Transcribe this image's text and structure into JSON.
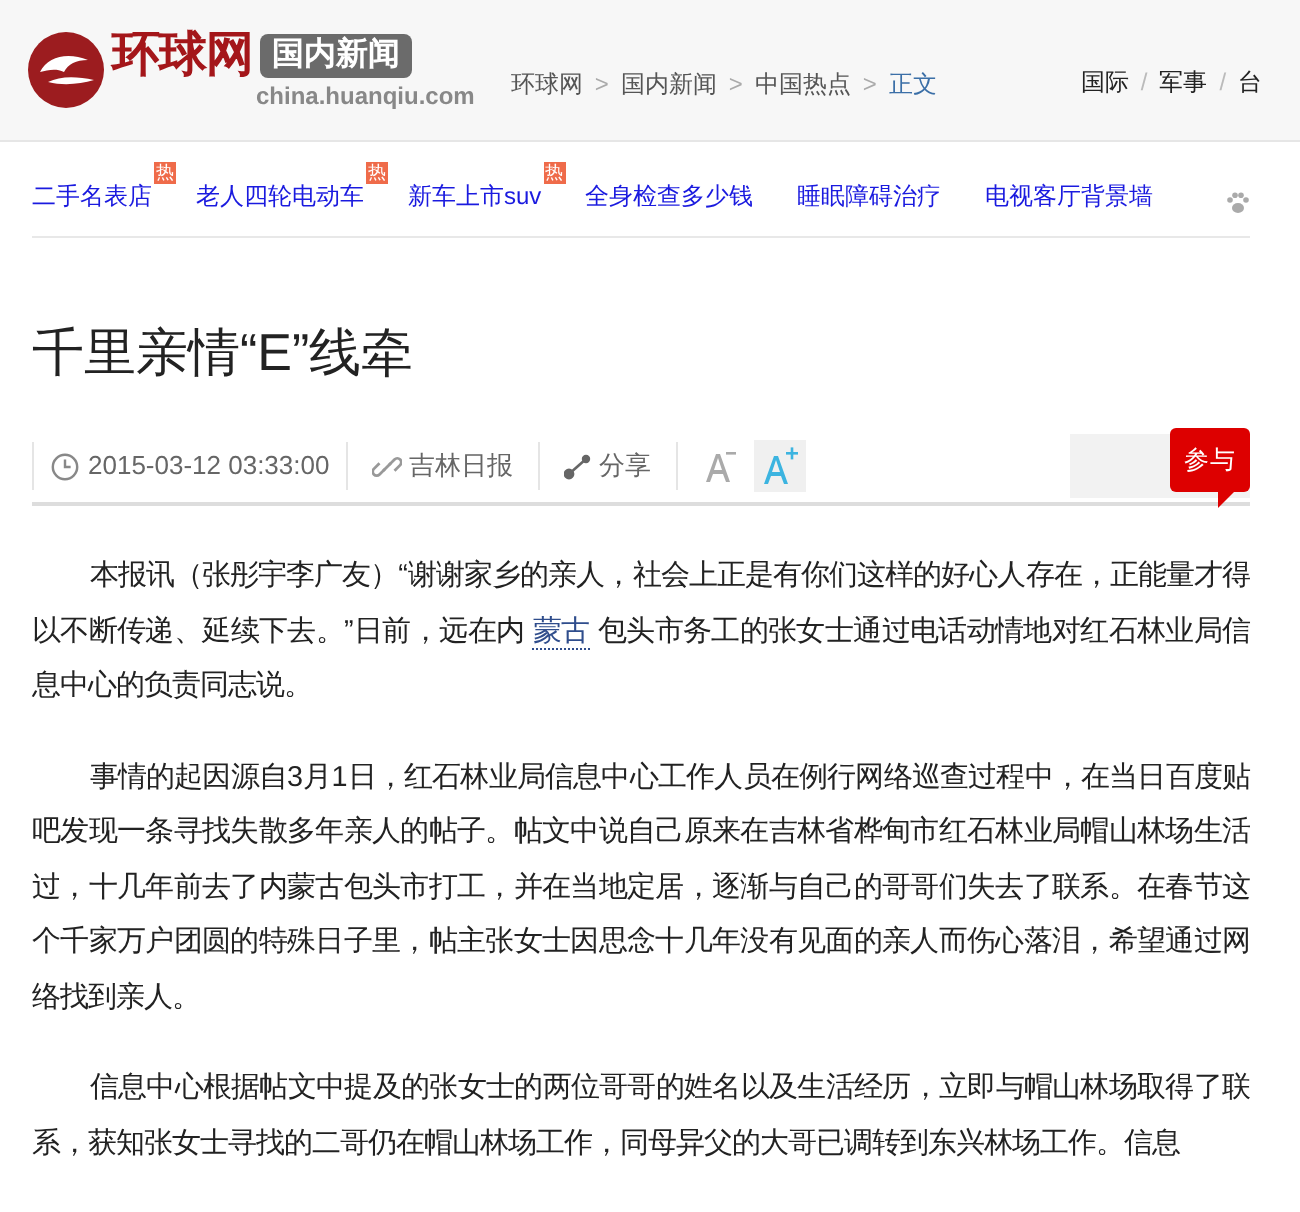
{
  "logo": {
    "brand": "环球网",
    "channel": "国内新闻",
    "domain": "china.huanqiu.com"
  },
  "breadcrumb": [
    {
      "label": "环球网",
      "selected": false
    },
    {
      "label": "国内新闻",
      "selected": false
    },
    {
      "label": "中国热点",
      "selected": false
    },
    {
      "label": "正文",
      "selected": true
    }
  ],
  "breadcrumb_separator": ">",
  "top_nav": [
    "国际",
    "军事",
    "台"
  ],
  "top_nav_separator": "/",
  "hot_links": [
    {
      "label": "二手名表店",
      "badge": "热"
    },
    {
      "label": "老人四轮电动车",
      "badge": "热"
    },
    {
      "label": "新车上市suv",
      "badge": "热"
    },
    {
      "label": "全身检查多少钱"
    },
    {
      "label": "睡眠障碍治疗"
    },
    {
      "label": "电视客厅背景墙"
    }
  ],
  "title": "千里亲情“E”线牵",
  "meta": {
    "date": "2015-03-12 03:33:00",
    "source": "吉林日报",
    "share": "分享",
    "join": "参与"
  },
  "paragraphs": [
    [
      {
        "text": "本报讯（张彤宇李广友）“谢谢家乡的亲人，社会上正是有你们这样的好心人存在，正能量才得以不断传递、延续下去。”日前，远在内 "
      },
      {
        "text": "蒙古",
        "kind": "link"
      },
      {
        "text": " 包头市务工的张女士通过电话动情地对红石林业局信息中心的负责同志说。"
      }
    ],
    [
      {
        "text": "事情的起因源自3月1日，红石林业局信息中心工作人员在例行网络巡查过程中，在当日百度贴吧发现一条寻找失散多年亲人的帖子。帖文中说自己原来在吉林省桦甸市红石林业局帽山林场生活过，十几年前去了内蒙古包头市打工，并在当地定居，逐渐与自己的哥哥们失去了联系。在春节这个千家万户团圆的特殊日子里，帖主张女士因思念十几年没有见面的亲人而伤心落泪，希望通过网络找到亲人。"
      }
    ],
    [
      {
        "text": "信息中心根据帖文中提及的张女士的两位哥哥的姓名以及生活经历，立即与帽山林场取得了联系，获知张女士寻找的二哥仍在帽山林场工作，同母异父的大哥已调转到东兴林场工作。信息"
      }
    ]
  ]
}
